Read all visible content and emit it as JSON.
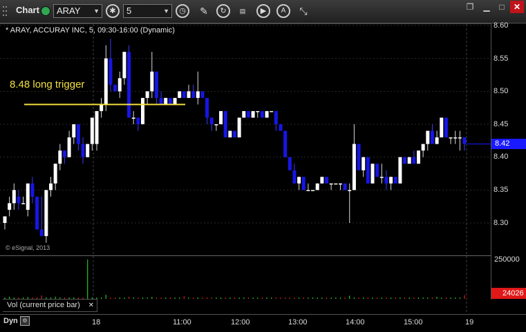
{
  "toolbar": {
    "title": "Chart",
    "symbol": "ARAY",
    "interval": "5"
  },
  "chart": {
    "header": "* ARAY, ACCURAY INC, 5, 09:30-16:00 (Dynamic)",
    "annotation": "8.48 long trigger",
    "copyright": "© eSignal, 2013",
    "last_price": "8.42",
    "price_ticks": [
      "8.60",
      "8.55",
      "8.50",
      "8.45",
      "8.40",
      "8.35",
      "8.30"
    ],
    "x_ticks": [
      "18",
      "11:00",
      "12:00",
      "13:00",
      "14:00",
      "15:00",
      "19"
    ],
    "dyn_label": "Dyn"
  },
  "volume": {
    "legend": "Vol (current price bar)",
    "max_label": "250000",
    "last_value": "24026"
  },
  "colors": {
    "up": "#ffffff",
    "down": "#1616e6",
    "trigger_line": "#f2e040",
    "vol_up": "#27c427",
    "vol_down": "#d32020"
  },
  "chart_data": {
    "type": "candlestick",
    "trigger_level": 8.48,
    "ylim": [
      8.27,
      8.61
    ],
    "candles": [
      [
        8.3,
        8.31,
        8.29,
        8.31
      ],
      [
        8.32,
        8.34,
        8.31,
        8.33
      ],
      [
        8.33,
        8.36,
        8.32,
        8.35
      ],
      [
        8.34,
        8.35,
        8.32,
        8.33
      ],
      [
        8.33,
        8.34,
        8.33,
        8.33
      ],
      [
        8.32,
        8.36,
        8.31,
        8.36
      ],
      [
        8.36,
        8.37,
        8.33,
        8.34
      ],
      [
        8.34,
        8.34,
        8.29,
        8.29
      ],
      [
        8.29,
        8.34,
        8.28,
        8.28
      ],
      [
        8.28,
        8.35,
        8.27,
        8.35
      ],
      [
        8.35,
        8.37,
        8.34,
        8.36
      ],
      [
        8.36,
        8.39,
        8.35,
        8.39
      ],
      [
        8.39,
        8.42,
        8.38,
        8.41
      ],
      [
        8.41,
        8.41,
        8.39,
        8.4
      ],
      [
        8.4,
        8.44,
        8.4,
        8.43
      ],
      [
        8.43,
        8.45,
        8.42,
        8.45
      ],
      [
        8.45,
        8.45,
        8.41,
        8.42
      ],
      [
        8.42,
        8.43,
        8.39,
        8.4
      ],
      [
        8.4,
        8.42,
        8.4,
        8.42
      ],
      [
        8.42,
        8.45,
        8.41,
        8.46
      ],
      [
        8.42,
        8.47,
        8.41,
        8.47
      ],
      [
        8.47,
        8.49,
        8.46,
        8.48
      ],
      [
        8.48,
        8.57,
        8.47,
        8.55
      ],
      [
        8.55,
        8.58,
        8.5,
        8.51
      ],
      [
        8.51,
        8.51,
        8.5,
        8.5
      ],
      [
        8.5,
        8.53,
        8.49,
        8.52
      ],
      [
        8.52,
        8.56,
        8.51,
        8.56
      ],
      [
        8.56,
        8.57,
        8.46,
        8.46
      ],
      [
        8.46,
        8.47,
        8.45,
        8.46
      ],
      [
        8.46,
        8.46,
        8.44,
        8.45
      ],
      [
        8.45,
        8.49,
        8.45,
        8.49
      ],
      [
        8.49,
        8.5,
        8.48,
        8.5
      ],
      [
        8.5,
        8.56,
        8.49,
        8.53
      ],
      [
        8.53,
        8.53,
        8.48,
        8.49
      ],
      [
        8.49,
        8.5,
        8.48,
        8.48
      ],
      [
        8.48,
        8.49,
        8.48,
        8.49
      ],
      [
        8.49,
        8.49,
        8.48,
        8.48
      ],
      [
        8.48,
        8.49,
        8.48,
        8.49
      ],
      [
        8.49,
        8.5,
        8.49,
        8.5
      ],
      [
        8.5,
        8.5,
        8.49,
        8.49
      ],
      [
        8.49,
        8.51,
        8.49,
        8.5
      ],
      [
        8.5,
        8.51,
        8.49,
        8.49
      ],
      [
        8.49,
        8.53,
        8.48,
        8.5
      ],
      [
        8.5,
        8.5,
        8.49,
        8.49
      ],
      [
        8.49,
        8.49,
        8.45,
        8.46
      ],
      [
        8.46,
        8.46,
        8.44,
        8.45
      ],
      [
        8.45,
        8.45,
        8.44,
        8.45
      ],
      [
        8.45,
        8.47,
        8.45,
        8.47
      ],
      [
        8.47,
        8.47,
        8.43,
        8.43
      ],
      [
        8.43,
        8.44,
        8.43,
        8.44
      ],
      [
        8.44,
        8.44,
        8.43,
        8.43
      ],
      [
        8.43,
        8.46,
        8.43,
        8.46
      ],
      [
        8.46,
        8.47,
        8.46,
        8.47
      ],
      [
        8.47,
        8.47,
        8.46,
        8.46
      ],
      [
        8.46,
        8.47,
        8.46,
        8.47
      ],
      [
        8.47,
        8.47,
        8.46,
        8.47
      ],
      [
        8.47,
        8.47,
        8.46,
        8.46
      ],
      [
        8.46,
        8.47,
        8.46,
        8.47
      ],
      [
        8.47,
        8.47,
        8.47,
        8.47
      ],
      [
        8.47,
        8.47,
        8.44,
        8.45
      ],
      [
        8.45,
        8.45,
        8.44,
        8.44
      ],
      [
        8.44,
        8.44,
        8.4,
        8.4
      ],
      [
        8.4,
        8.4,
        8.38,
        8.38
      ],
      [
        8.38,
        8.39,
        8.36,
        8.36
      ],
      [
        8.36,
        8.37,
        8.35,
        8.37
      ],
      [
        8.37,
        8.37,
        8.35,
        8.35
      ],
      [
        8.35,
        8.36,
        8.35,
        8.35
      ],
      [
        8.35,
        8.35,
        8.35,
        8.35
      ],
      [
        8.35,
        8.36,
        8.35,
        8.36
      ],
      [
        8.36,
        8.37,
        8.36,
        8.37
      ],
      [
        8.37,
        8.37,
        8.36,
        8.36
      ],
      [
        8.36,
        8.36,
        8.35,
        8.36
      ],
      [
        8.36,
        8.36,
        8.36,
        8.36
      ],
      [
        8.36,
        8.36,
        8.35,
        8.36
      ],
      [
        8.36,
        8.36,
        8.35,
        8.35
      ],
      [
        8.35,
        8.36,
        8.3,
        8.35
      ],
      [
        8.35,
        8.45,
        8.35,
        8.42
      ],
      [
        8.42,
        8.42,
        8.38,
        8.38
      ],
      [
        8.38,
        8.4,
        8.37,
        8.4
      ],
      [
        8.4,
        8.4,
        8.36,
        8.36
      ],
      [
        8.36,
        8.39,
        8.36,
        8.39
      ],
      [
        8.39,
        8.39,
        8.37,
        8.37
      ],
      [
        8.37,
        8.39,
        8.36,
        8.37
      ],
      [
        8.37,
        8.38,
        8.35,
        8.36
      ],
      [
        8.36,
        8.37,
        8.35,
        8.37
      ],
      [
        8.37,
        8.37,
        8.36,
        8.36
      ],
      [
        8.36,
        8.4,
        8.36,
        8.4
      ],
      [
        8.4,
        8.4,
        8.39,
        8.39
      ],
      [
        8.39,
        8.4,
        8.39,
        8.4
      ],
      [
        8.4,
        8.41,
        8.39,
        8.39
      ],
      [
        8.39,
        8.41,
        8.39,
        8.41
      ],
      [
        8.41,
        8.42,
        8.4,
        8.42
      ],
      [
        8.42,
        8.43,
        8.41,
        8.44
      ],
      [
        8.44,
        8.45,
        8.42,
        8.42
      ],
      [
        8.42,
        8.44,
        8.42,
        8.43
      ],
      [
        8.43,
        8.46,
        8.43,
        8.46
      ],
      [
        8.46,
        8.46,
        8.43,
        8.43
      ],
      [
        8.43,
        8.43,
        8.42,
        8.43
      ],
      [
        8.43,
        8.44,
        8.42,
        8.43
      ],
      [
        8.43,
        8.44,
        8.41,
        8.43
      ],
      [
        8.43,
        8.43,
        8.41,
        8.42
      ]
    ],
    "volume": [
      9000,
      14000,
      6000,
      4000,
      3000,
      12000,
      9000,
      8000,
      22000,
      10000,
      6000,
      14000,
      9000,
      5000,
      8000,
      10000,
      7000,
      4000,
      250000,
      6000,
      4000,
      9000,
      26000,
      8000,
      5000,
      7000,
      4000,
      14000,
      9000,
      5000,
      6000,
      5000,
      13000,
      7000,
      4000,
      3000,
      4000,
      3000,
      5000,
      17000,
      4000,
      5000,
      4000,
      3000,
      9000,
      6000,
      4000,
      3000,
      6000,
      5000,
      3000,
      4000,
      6000,
      3000,
      3000,
      4000,
      3000,
      3000,
      3000,
      6000,
      4000,
      5000,
      7000,
      4000,
      3000,
      4000,
      3000,
      3000,
      4000,
      3000,
      4000,
      3000,
      3000,
      4000,
      5000,
      20000,
      5000,
      4000,
      4000,
      7000,
      4000,
      4000,
      3000,
      5000,
      6000,
      4000,
      3000,
      4000,
      3000,
      3000,
      3000,
      4000,
      5000,
      6000,
      13000,
      6000,
      5000,
      9000,
      5000,
      4000,
      24026
    ]
  }
}
